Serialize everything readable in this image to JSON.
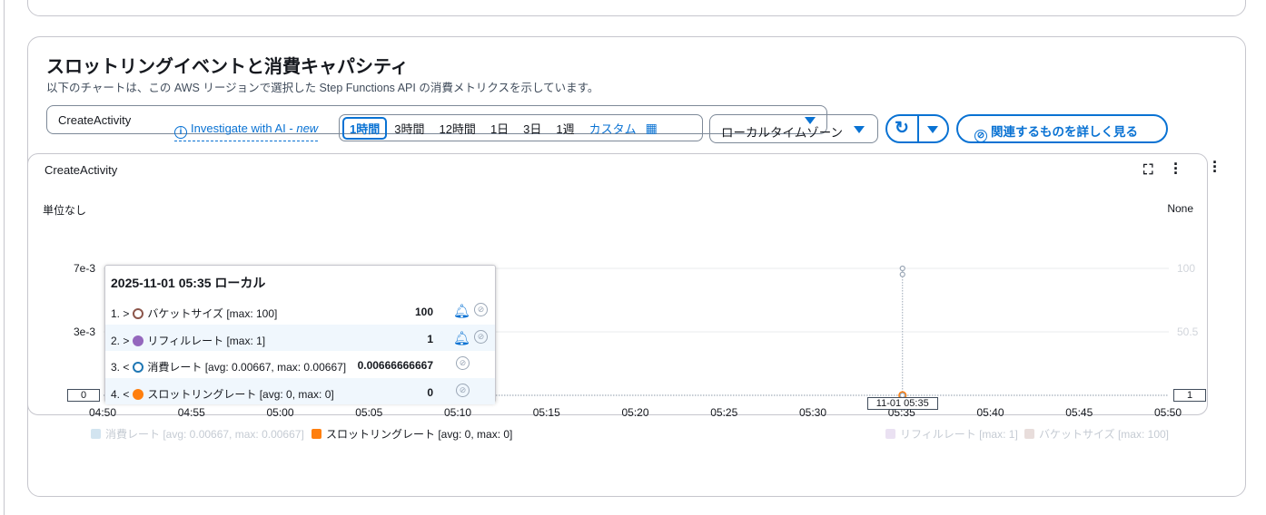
{
  "section": {
    "title": "スロットリングイベントと消費キャパシティ",
    "description": "以下のチャートは、この AWS リージョンで選択した Step Functions API の消費メトリクスを示しています。",
    "api_select": "CreateActivity"
  },
  "toolbar": {
    "ai_link": "Investigate with AI - ",
    "ai_new": "new",
    "ranges": [
      "1時間",
      "3時間",
      "12時間",
      "1日",
      "3日",
      "1週"
    ],
    "selected_range": "1時間",
    "custom": "カスタム",
    "timezone": "ローカルタイムゾーン",
    "explore": "関連するものを詳しく見る"
  },
  "widget": {
    "title": "CreateActivity",
    "left_unit": "単位なし",
    "right_unit": "None"
  },
  "tooltip": {
    "header": "2025-11-01 05:35 ローカル",
    "rows": [
      {
        "index": "1. >",
        "label": "バケットサイズ [max: 100]",
        "value": "100",
        "color": "#8c564b",
        "filled": false,
        "alarm": true
      },
      {
        "index": "2. >",
        "label": "リフィルレート [max: 1]",
        "value": "1",
        "color": "#9467bd",
        "filled": true,
        "alarm": true
      },
      {
        "index": "3. <",
        "label": "消費レート [avg: 0.00667, max: 0.00667]",
        "value": "0.00666666667",
        "color": "#1f77b4",
        "filled": false,
        "alarm": false
      },
      {
        "index": "4. <",
        "label": "スロットリングレート [avg: 0, max: 0]",
        "value": "0",
        "color": "#ff7f0e",
        "filled": true,
        "alarm": false
      }
    ]
  },
  "cursor_label": "11-01 05:35",
  "chart_data": {
    "type": "line",
    "x": [
      "04:50",
      "04:55",
      "05:00",
      "05:05",
      "05:10",
      "05:15",
      "05:20",
      "05:25",
      "05:30",
      "05:35",
      "05:40",
      "05:45",
      "05:50"
    ],
    "left_axis": {
      "label": "単位なし",
      "ticks": [
        "7e-3",
        "3e-3"
      ],
      "min_label": "0",
      "ylim": [
        0,
        0.007
      ]
    },
    "right_axis": {
      "label": "None",
      "ticks": [
        "100",
        "50.5"
      ],
      "min_label": "1",
      "ylim": [
        1,
        100
      ]
    },
    "series": [
      {
        "name": "消費レート",
        "legend": "消費レート [avg: 0.00667, max: 0.00667]",
        "axis": "left",
        "x": "05:35",
        "value": 0.00666666667,
        "color": "#1f77b4",
        "hidden": true
      },
      {
        "name": "スロットリングレート",
        "legend": "スロットリングレート [avg: 0, max: 0]",
        "axis": "left",
        "x": "05:35",
        "value": 0,
        "color": "#ff7f0e",
        "hidden": false
      },
      {
        "name": "リフィルレート",
        "legend": "リフィルレート [max: 1]",
        "axis": "right",
        "x": "05:35",
        "value": 1,
        "color": "#9467bd",
        "hidden": true
      },
      {
        "name": "バケットサイズ",
        "legend": "バケットサイズ [max: 100]",
        "axis": "right",
        "x": "05:35",
        "value": 100,
        "color": "#8c564b",
        "hidden": true
      }
    ]
  }
}
